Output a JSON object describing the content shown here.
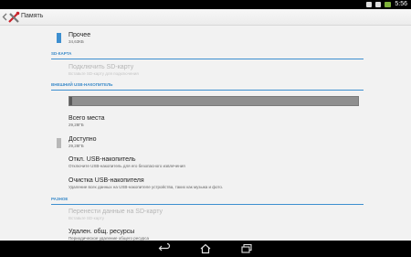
{
  "status_bar": {
    "time": "5:56"
  },
  "action_bar": {
    "title": "Память"
  },
  "sections": {
    "other": {
      "title": "Прочее",
      "value": "34,63КБ"
    },
    "sd_card": {
      "header": "SD-КАРТА",
      "mount_title": "Подключить SD-карту",
      "mount_subtitle": "Вставьте SD-карту для подключения"
    },
    "usb": {
      "header": "ВНЕШНИЙ USB-НАКОПИТЕЛЬ",
      "used_fraction": 0.01,
      "total_title": "Всего места",
      "total_value": "29,28ГБ",
      "available_title": "Доступно",
      "available_value": "29,28ГБ",
      "unmount_title": "Откл. USB-накопитель",
      "unmount_subtitle": "Отключите USB-накопитель для его безопасного извлечения",
      "erase_title": "Очистка USB-накопителя",
      "erase_subtitle": "Удаление всех данных на USB-накопителе устройства, таких как музыка и фото."
    },
    "misc": {
      "header": "РАЗНОЕ",
      "transfer_title": "Перенести данные на SD-карту",
      "transfer_subtitle": "Вставьте SD-карту",
      "clear_title": "Удален. общ. ресурсы",
      "clear_subtitle": "Периодическое удаление общего ресурса"
    }
  },
  "colors": {
    "accent": "#3d8fd0",
    "statusbar": "#000000",
    "battery": "#7fb23a"
  }
}
